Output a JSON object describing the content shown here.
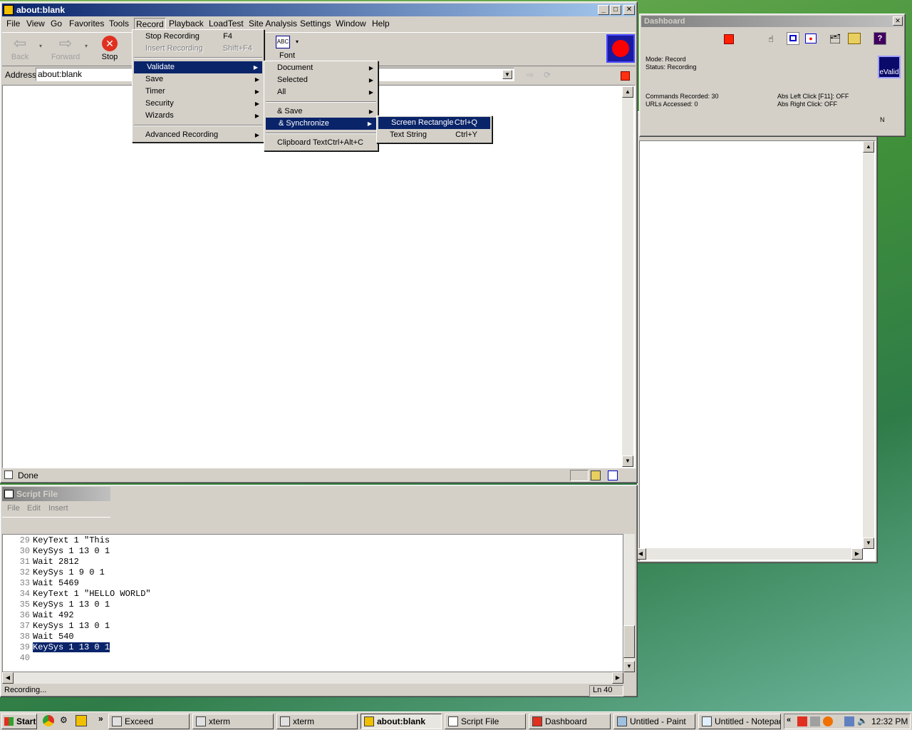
{
  "browser": {
    "title": "about:blank",
    "menus": [
      "File",
      "View",
      "Go",
      "Favorites",
      "Tools",
      "Record",
      "Playback",
      "LoadTest",
      "Site Analysis",
      "Settings",
      "Window",
      "Help"
    ],
    "toolbar": {
      "back": "Back",
      "forward": "Forward",
      "stop": "Stop",
      "font": "Font"
    },
    "address_label": "Address",
    "address_value": "about:blank",
    "status": "Done"
  },
  "record_menu": {
    "items": [
      {
        "label": "Stop Recording",
        "shortcut": "F4"
      },
      {
        "label": "Insert Recording",
        "shortcut": "Shift+F4"
      },
      {
        "label": "Validate"
      },
      {
        "label": "Save"
      },
      {
        "label": "Timer"
      },
      {
        "label": "Security"
      },
      {
        "label": "Wizards"
      },
      {
        "label": "Advanced Recording"
      }
    ]
  },
  "validate_menu": {
    "items": [
      {
        "label": "Document"
      },
      {
        "label": "Selected"
      },
      {
        "label": "All"
      },
      {
        "label": "& Save"
      },
      {
        "label": "& Synchronize"
      },
      {
        "label": "Clipboard Text",
        "shortcut": "Ctrl+Alt+C"
      }
    ]
  },
  "sync_menu": {
    "items": [
      {
        "label": "Screen Rectangle",
        "shortcut": "Ctrl+Q"
      },
      {
        "label": "Text String",
        "shortcut": "Ctrl+Y"
      }
    ]
  },
  "dashboard": {
    "title": "Dashboard",
    "mode": "Mode: Record",
    "status": "Status: Recording",
    "commands": "Commands Recorded: 30",
    "urls": "URLs Accessed: 0",
    "abs_left": "Abs Left Click [F11]: OFF",
    "abs_right": "Abs Right Click: OFF",
    "logo": "eValid",
    "edge_letter": "N"
  },
  "script": {
    "title": "Script File",
    "menus": [
      "File",
      "Edit",
      "Insert"
    ],
    "lines": [
      {
        "n": "29",
        "t": "KeyText 1 \"This"
      },
      {
        "n": "30",
        "t": "KeySys 1 13 0 1"
      },
      {
        "n": "31",
        "t": "Wait 2812"
      },
      {
        "n": "32",
        "t": "KeySys 1 9 0 1"
      },
      {
        "n": "33",
        "t": "Wait 5469"
      },
      {
        "n": "34",
        "t": "KeyText 1 \"HELLO WORLD\""
      },
      {
        "n": "35",
        "t": "KeySys 1 13 0 1"
      },
      {
        "n": "36",
        "t": "Wait 492"
      },
      {
        "n": "37",
        "t": "KeySys 1 13 0 1"
      },
      {
        "n": "38",
        "t": "Wait 540"
      },
      {
        "n": "39",
        "t": "KeySys 1 13 0 1"
      },
      {
        "n": "40",
        "t": ""
      }
    ],
    "status_left": "Recording...",
    "status_right": "Ln 40"
  },
  "taskbar": {
    "start": "Start",
    "tasks": [
      "Exceed",
      "xterm",
      "xterm",
      "about:blank",
      "Script File",
      "Dashboard",
      "Untitled - Paint",
      "Untitled - Notepad"
    ],
    "clock": "12:32 PM"
  },
  "colors": {
    "title_active": "#0a246a",
    "menu_highlight": "#0a246a",
    "record_red": "#ff0000"
  }
}
